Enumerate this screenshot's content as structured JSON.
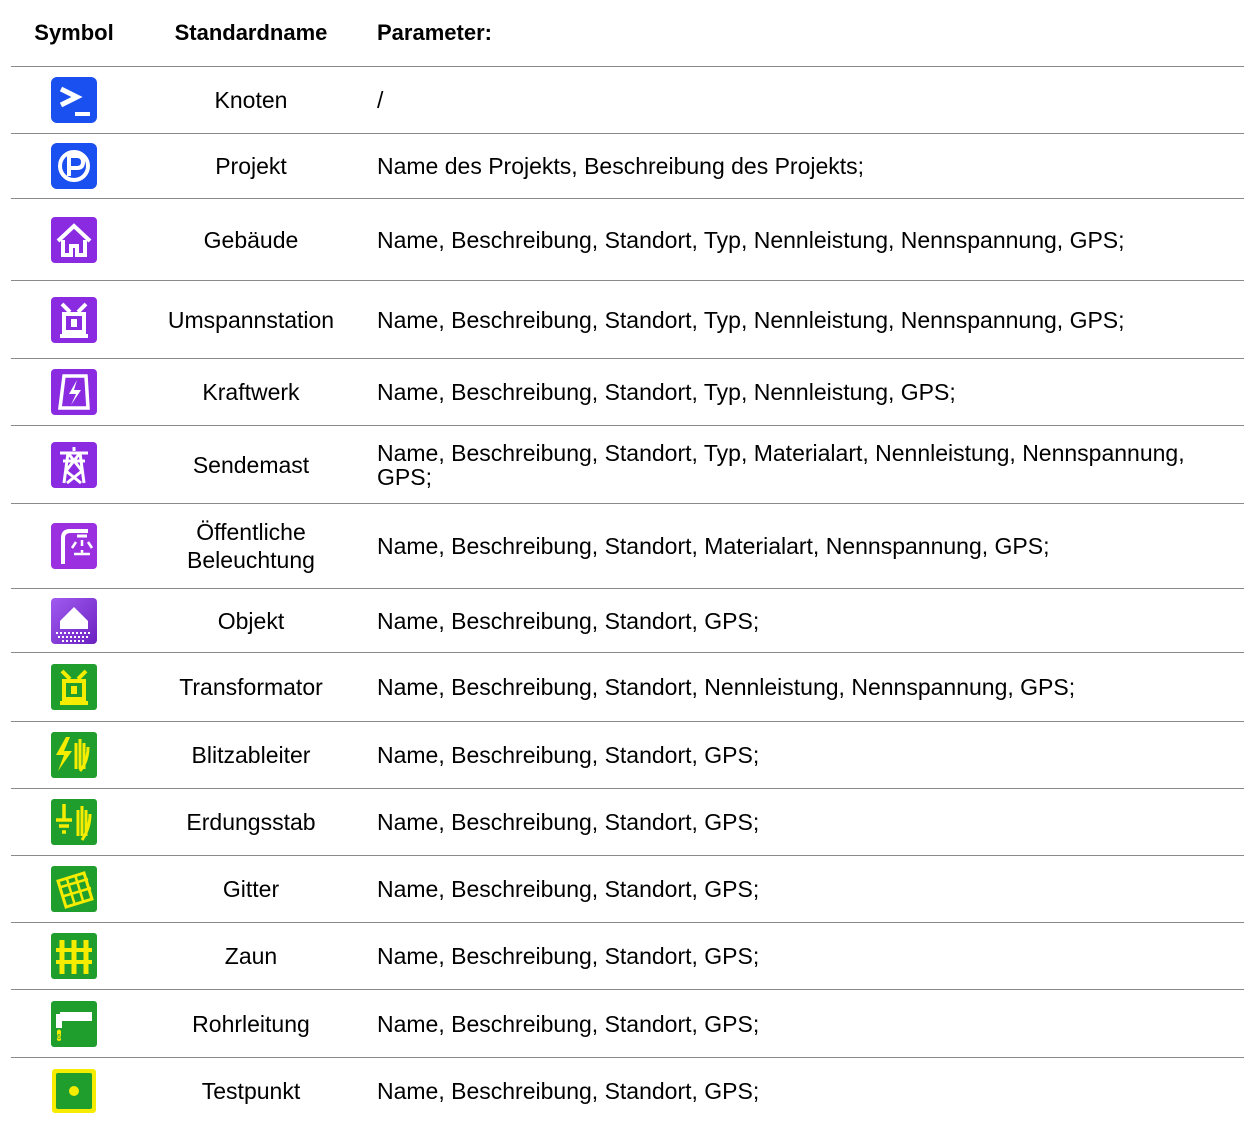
{
  "header": {
    "symbol": "Symbol",
    "standard_name": "Standardname",
    "parameters": "Parameter:"
  },
  "rows": [
    {
      "icon": "terminal-node-icon",
      "name": "Knoten",
      "params": "/"
    },
    {
      "icon": "project-icon",
      "name": "Projekt",
      "params": "Name des Projekts, Beschreibung des Projekts;"
    },
    {
      "icon": "building-icon",
      "name": "Gebäude",
      "params": "Name, Beschreibung, Standort, Typ, Nennleistung, Nennspannung, GPS;"
    },
    {
      "icon": "substation-icon",
      "name": "Umspannstation",
      "params": "Name, Beschreibung, Standort, Typ, Nennleistung, Nennspannung, GPS;"
    },
    {
      "icon": "power-plant-icon",
      "name": "Kraftwerk",
      "params": "Name, Beschreibung, Standort, Typ, Nennleistung, GPS;"
    },
    {
      "icon": "transmission-tower-icon",
      "name": "Sendemast",
      "params": "Name, Beschreibung, Standort, Typ, Materialart, Nennleistung, Nennspannung, GPS;"
    },
    {
      "icon": "street-light-icon",
      "name": "Öffentliche Beleuchtung",
      "params": "Name, Beschreibung, Standort, Materialart, Nennspannung, GPS;"
    },
    {
      "icon": "object-icon",
      "name": "Objekt",
      "params": "Name, Beschreibung, Standort, GPS;"
    },
    {
      "icon": "transformer-icon",
      "name": "Transformator",
      "params": "Name, Beschreibung, Standort, Nennleistung, Nennspannung, GPS;"
    },
    {
      "icon": "lightning-arrester-icon",
      "name": "Blitzableiter",
      "params": "Name, Beschreibung, Standort, GPS;"
    },
    {
      "icon": "grounding-rod-icon",
      "name": "Erdungsstab",
      "params": "Name, Beschreibung, Standort, GPS;"
    },
    {
      "icon": "grid-icon",
      "name": "Gitter",
      "params": "Name, Beschreibung, Standort, GPS;"
    },
    {
      "icon": "fence-icon",
      "name": "Zaun",
      "params": "Name, Beschreibung, Standort, GPS;"
    },
    {
      "icon": "pipeline-icon",
      "name": "Rohrleitung",
      "params": "Name, Beschreibung, Standort, GPS;"
    },
    {
      "icon": "test-point-icon",
      "name": "Testpunkt",
      "params": "Name, Beschreibung, Standort, GPS;"
    }
  ],
  "colors": {
    "blue": "#1a4ff0",
    "purple": "#8a2be2",
    "green": "#1f9e2e",
    "yellow": "#f5ec00",
    "rule": "#8a8a8a"
  }
}
